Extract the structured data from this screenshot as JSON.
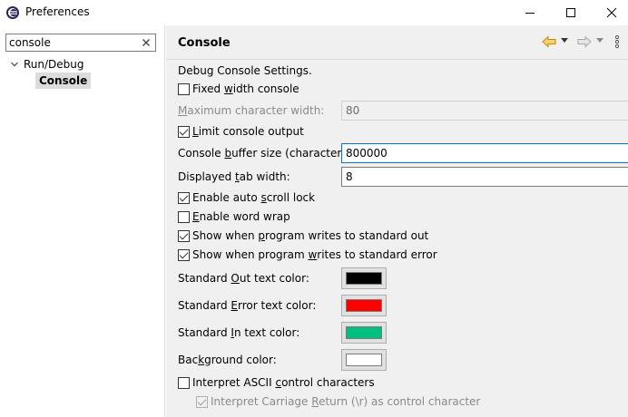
{
  "window": {
    "title": "Preferences"
  },
  "sidebar": {
    "filter_value": "console",
    "tree": [
      {
        "label": "Run/Debug",
        "expanded": true
      },
      {
        "label": "Console",
        "selected": true
      }
    ]
  },
  "page": {
    "title": "Console",
    "section_label": "Debug Console Settings.",
    "fixed_width": {
      "pre": "Fixed ",
      "u": "w",
      "post": "idth console",
      "checked": false
    },
    "max_char_width": {
      "pre": "",
      "u": "M",
      "post": "aximum character width:",
      "value": "80",
      "enabled": false
    },
    "limit_output": {
      "pre": "",
      "u": "L",
      "post": "imit console output",
      "checked": true
    },
    "buffer_size": {
      "pre": "Console ",
      "u": "b",
      "post": "uffer size (characters):",
      "value": "800000"
    },
    "tab_width": {
      "pre": "Displayed ",
      "u": "t",
      "post": "ab width:",
      "value": "8"
    },
    "auto_scroll": {
      "pre": "Enable auto ",
      "u": "s",
      "post": "croll lock",
      "checked": true
    },
    "word_wrap": {
      "pre": "",
      "u": "E",
      "post": "nable word wrap",
      "checked": false
    },
    "show_out": {
      "pre": "Show when ",
      "u": "p",
      "post": "rogram writes to standard out",
      "checked": true
    },
    "show_err": {
      "pre": "Show when program ",
      "u": "w",
      "post": "rites to standard error",
      "checked": true
    },
    "std_out_color": {
      "pre": "Standard ",
      "u": "O",
      "post": "ut text color:",
      "color": "#000000"
    },
    "std_err_color": {
      "pre": "Standard ",
      "u": "E",
      "post": "rror text color:",
      "color": "#ff0000"
    },
    "std_in_color": {
      "pre": "Standard ",
      "u": "I",
      "post": "n text color:",
      "color": "#00c080"
    },
    "bg_color": {
      "pre": "Bac",
      "u": "k",
      "post": "ground color:",
      "color": "#ffffff"
    },
    "ascii_control": {
      "pre": "Interpret ASCII ",
      "u": "c",
      "post": "ontrol characters",
      "checked": false
    },
    "carriage_return": {
      "pre": "Interpret Carriage ",
      "u": "R",
      "post": "eturn (\\r) as control character",
      "checked": true,
      "enabled": false
    }
  },
  "icons": {
    "back": "back-arrow-icon",
    "forward": "forward-arrow-icon",
    "menu": "view-menu-icon"
  },
  "colors": {
    "accent": "#0078d7",
    "nav_back": "#e8a317"
  }
}
